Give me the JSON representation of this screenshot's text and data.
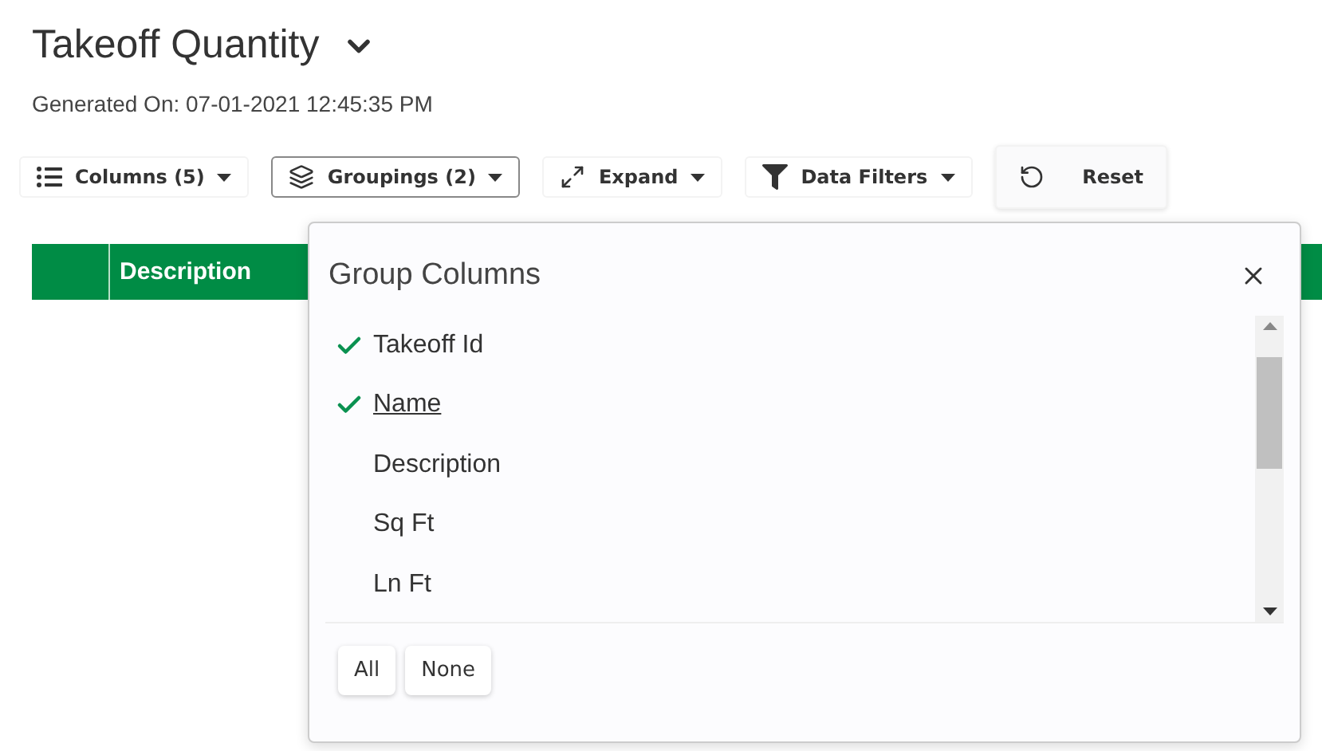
{
  "title": "Takeoff Quantity",
  "generated": "Generated On: 07-01-2021 12:45:35 PM",
  "toolbar": [
    {
      "kind": "columns",
      "label": "Columns (5)",
      "dropdown": true,
      "selected": false
    },
    {
      "kind": "groupings",
      "label": "Groupings (2)",
      "dropdown": true,
      "selected": true
    },
    {
      "kind": "expand",
      "label": "Expand",
      "dropdown": true,
      "selected": false
    },
    {
      "kind": "filter",
      "label": "Data Filters",
      "dropdown": true,
      "selected": false
    },
    {
      "kind": "reset",
      "label": "Reset",
      "dropdown": false,
      "selected": false
    }
  ],
  "table": {
    "columns": [
      "Description"
    ]
  },
  "popup": {
    "title": "Group Columns",
    "items": [
      {
        "label": "Takeoff Id",
        "checked": true,
        "hovered": false
      },
      {
        "label": "Name",
        "checked": true,
        "hovered": true
      },
      {
        "label": "Description",
        "checked": false,
        "hovered": false
      },
      {
        "label": "Sq Ft",
        "checked": false,
        "hovered": false
      },
      {
        "label": "Ln Ft",
        "checked": false,
        "hovered": false
      }
    ],
    "buttons": [
      "All",
      "None"
    ]
  }
}
